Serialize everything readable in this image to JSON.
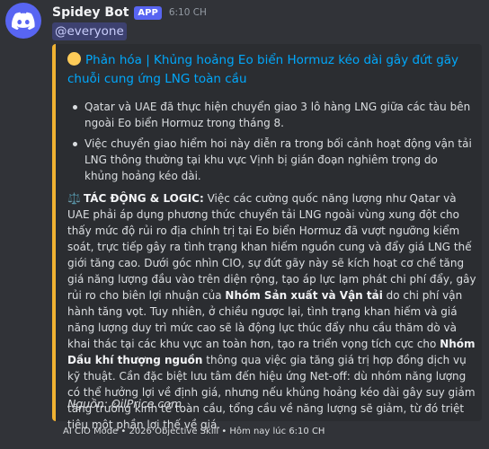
{
  "message": {
    "username": "Spidey Bot",
    "badge": "APP",
    "timestamp": "6:10 CH",
    "mention": "@everyone"
  },
  "embed": {
    "accent_color": "#f0b232",
    "title_icon": "yellow-circle-icon",
    "title": "Phản hóa | Khủng hoảng Eo biển Hormuz kéo dài gây đứt gãy chuỗi cung ứng LNG toàn cầu",
    "bullets": [
      "Qatar và UAE đã thực hiện chuyển giao 3 lô hàng LNG giữa các tàu bên ngoài Eo biển Hormuz trong tháng 8.",
      "Việc chuyển giao hiểm hoi này diễn ra trong bối cảnh hoạt động vận tải LNG thông thường tại khu vực Vịnh bị gián đoạn nghiêm trọng do khủng hoảng kéo dài."
    ],
    "impact": {
      "icon": "balance-scale-icon",
      "label": "TÁC ĐỘNG & LOGIC:",
      "text1": " Việc các cường quốc năng lượng như Qatar và UAE phải áp dụng phương thức chuyển tải LNG ngoài vùng xung đột cho thấy mức độ rủi ro địa chính trị tại Eo biển Hormuz đã vượt ngưỡng kiểm soát, trực tiếp gây ra tình trạng khan hiếm nguồn cung và đẩy giá LNG thế giới tăng cao. Dưới góc nhìn CIO, sự đứt gãy này sẽ kích hoạt cơ chế tăng giá năng lượng đầu vào trên diện rộng, tạo áp lực lạm phát chi phí đẩy, gây rủi ro cho biên lợi nhuận của ",
      "bold1": "Nhóm Sản xuất và Vận tải",
      "text2": " do chi phí vận hành tăng vọt. Tuy nhiên, ở chiều ngược lại, tình trạng khan hiếm và giá năng lượng duy trì mức cao sẽ là động lực thúc đẩy nhu cầu thăm dò và khai thác tại các khu vực an toàn hơn, tạo ra triển vọng tích cực cho ",
      "bold2": "Nhóm Dầu khí thượng nguồn",
      "text3": " thông qua việc gia tăng giá trị hợp đồng dịch vụ kỹ thuật. Cần đặc biệt lưu tâm đến hiệu ứng Net-off: dù nhóm năng lượng có thể hưởng lợi về định giá, nhưng nếu khủng hoảng kéo dài gây suy giảm tăng trưởng kinh tế toàn cầu, tổng cầu về năng lượng sẽ giảm, từ đó triệt tiêu một phần lợi thế về giá."
    },
    "source": "Nguồn: OilPrice.com"
  },
  "footer": {
    "text": "AI CIO Mode • 2026 Objective Skill • Hôm nay lúc 6:10 CH"
  }
}
